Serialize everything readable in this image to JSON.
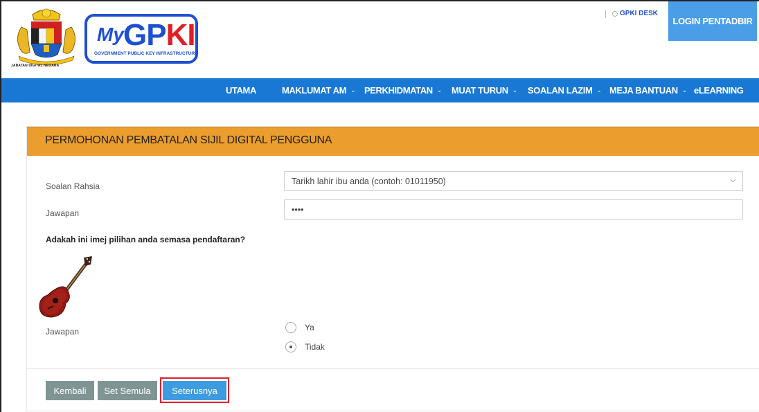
{
  "header": {
    "crest_caption": "JABATAN DIGITAL NEGARA",
    "logo": {
      "my": "My",
      "gp": "GP",
      "ki": "KI",
      "subtitle": "GOVERNMENT PUBLIC KEY INFRASTRUCTURE"
    },
    "separator": "|",
    "desk_link": "GPKI DESK",
    "login_button": "LOGIN PENTADBIR"
  },
  "nav": {
    "items": [
      {
        "label": "UTAMA",
        "dropdown": false
      },
      {
        "label": "MAKLUMAT AM",
        "dropdown": true
      },
      {
        "label": "PERKHIDMATAN",
        "dropdown": true
      },
      {
        "label": "MUAT TURUN",
        "dropdown": true
      },
      {
        "label": "SOALAN LAZIM",
        "dropdown": true
      },
      {
        "label": "MEJA BANTUAN",
        "dropdown": true
      },
      {
        "label": "eLEARNING",
        "dropdown": false
      }
    ],
    "chevron": "⌄"
  },
  "panel": {
    "title": "PERMOHONAN PEMBATALAN SIJIL DIGITAL PENGGUNA",
    "secret_question_label": "Soalan Rahsia",
    "secret_question_value": "Tarikh lahir ibu anda (contoh: 01011950)",
    "answer_label": "Jawapan",
    "answer_value": "••••",
    "image_question": "Adakah ini imej pilihan anda semasa pendaftaran?",
    "image_answer_label": "Jawapan",
    "options": [
      {
        "label": "Ya",
        "checked": false
      },
      {
        "label": "Tidak",
        "checked": true
      }
    ],
    "buttons": {
      "back": "Kembali",
      "reset": "Set Semula",
      "next": "Seterusnya"
    }
  },
  "icons": {
    "select_arrow": "chevron-down-icon",
    "desk": "globe-icon",
    "image": "guitar-image"
  },
  "colors": {
    "nav": "#1878d4",
    "panel_header": "#eb9d2d",
    "login": "#4a9ee8",
    "primary_button": "#3d9be0",
    "secondary_button": "#7f9594",
    "highlight": "#e01e26"
  }
}
